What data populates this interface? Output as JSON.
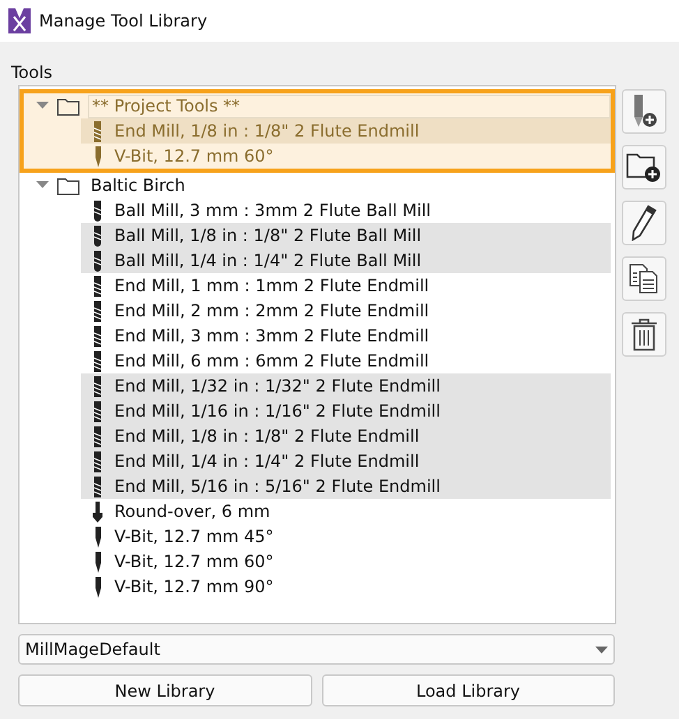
{
  "window": {
    "title": "Manage Tool Library"
  },
  "tools_label": "Tools",
  "tree": [
    {
      "label": "** Project Tools **",
      "expanded": true,
      "highlighted": true,
      "children": [
        {
          "label": "End Mill, 1/8 in : 1/8\" 2 Flute Endmill",
          "kind": "endmill",
          "selected": true
        },
        {
          "label": "V-Bit, 12.7 mm 60°",
          "kind": "vbit",
          "selected": false
        }
      ]
    },
    {
      "label": "Baltic Birch",
      "expanded": true,
      "highlighted": false,
      "children": [
        {
          "label": "Ball Mill, 3 mm : 3mm 2 Flute Ball Mill",
          "kind": "ballmill",
          "selected": false
        },
        {
          "label": "Ball Mill, 1/8 in : 1/8\" 2 Flute Ball Mill",
          "kind": "ballmill",
          "selected": true
        },
        {
          "label": "Ball Mill, 1/4 in : 1/4\" 2 Flute Ball Mill",
          "kind": "ballmill",
          "selected": true
        },
        {
          "label": "End Mill, 1 mm : 1mm 2 Flute Endmill",
          "kind": "endmill",
          "selected": false
        },
        {
          "label": "End Mill, 2 mm : 2mm 2 Flute Endmill",
          "kind": "endmill",
          "selected": false
        },
        {
          "label": "End Mill, 3 mm : 3mm 2 Flute Endmill",
          "kind": "endmill",
          "selected": false
        },
        {
          "label": "End Mill, 6 mm : 6mm 2 Flute Endmill",
          "kind": "endmill",
          "selected": false
        },
        {
          "label": "End Mill, 1/32 in : 1/32\" 2 Flute Endmill",
          "kind": "endmill",
          "selected": true
        },
        {
          "label": "End Mill, 1/16 in : 1/16\" 2 Flute Endmill",
          "kind": "endmill",
          "selected": true
        },
        {
          "label": "End Mill, 1/8 in : 1/8\" 2 Flute Endmill",
          "kind": "endmill",
          "selected": true
        },
        {
          "label": "End Mill, 1/4 in : 1/4\" 2 Flute Endmill",
          "kind": "endmill",
          "selected": true
        },
        {
          "label": "End Mill, 5/16 in : 5/16\" 2 Flute Endmill",
          "kind": "endmill",
          "selected": true
        },
        {
          "label": "Round-over, 6 mm",
          "kind": "roundover",
          "selected": false
        },
        {
          "label": "V-Bit, 12.7 mm 45°",
          "kind": "vbit",
          "selected": false
        },
        {
          "label": "V-Bit, 12.7 mm 60°",
          "kind": "vbit",
          "selected": false
        },
        {
          "label": "V-Bit, 12.7 mm 90°",
          "kind": "vbit",
          "selected": false
        }
      ]
    }
  ],
  "library_select": {
    "value": "MillMageDefault"
  },
  "buttons": [
    "New Library",
    "Load Library"
  ]
}
